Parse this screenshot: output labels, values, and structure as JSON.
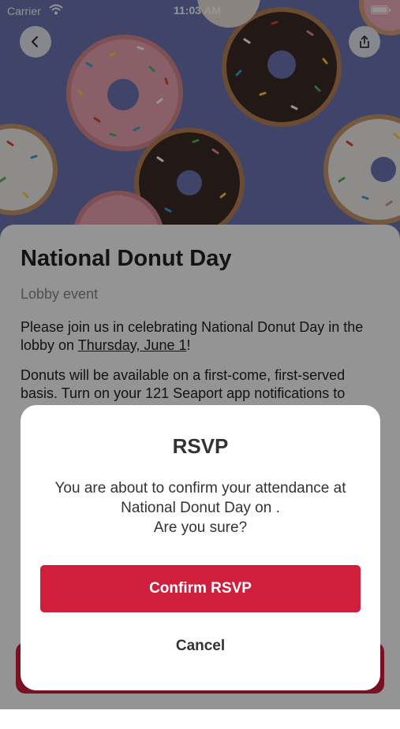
{
  "status_bar": {
    "carrier": "Carrier",
    "time": "11:03 AM"
  },
  "event": {
    "title": "National Donut Day",
    "subtitle": "Lobby event",
    "desc1_prefix": "Please join us in celebrating National Donut Day in the lobby on ",
    "desc1_date": "Thursday, June 1",
    "desc1_suffix": "!",
    "desc2": "Donuts will be available on a first-come, first-served basis. Turn on your 121 Seaport app notifications to"
  },
  "dialog": {
    "title": "RSVP",
    "message_line1": "You are about to confirm your attendance at",
    "message_line2": "National Donut Day on .",
    "message_line3": "Are you sure?",
    "confirm_label": "Confirm RSVP",
    "cancel_label": "Cancel"
  },
  "colors": {
    "accent": "#cf1f3d",
    "hero_bg": "#6f76b6"
  },
  "icons": {
    "back": "chevron-left-icon",
    "share": "share-icon",
    "wifi": "wifi-icon",
    "battery": "battery-icon"
  }
}
